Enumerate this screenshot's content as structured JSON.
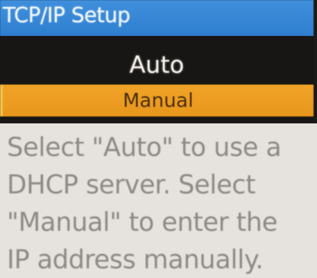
{
  "header": {
    "title": "TCP/IP Setup"
  },
  "menu": {
    "options": [
      "Auto",
      "Manual"
    ],
    "selected": "Manual"
  },
  "help": {
    "text": "Select \"Auto\" to use a DHCP server. Select \"Manual\" to enter the IP address manually."
  },
  "colors": {
    "title_bar": "#3a8ad8",
    "menu_background": "#181614",
    "selected_highlight": "#ec9c22",
    "help_background": "#e6e3de"
  }
}
